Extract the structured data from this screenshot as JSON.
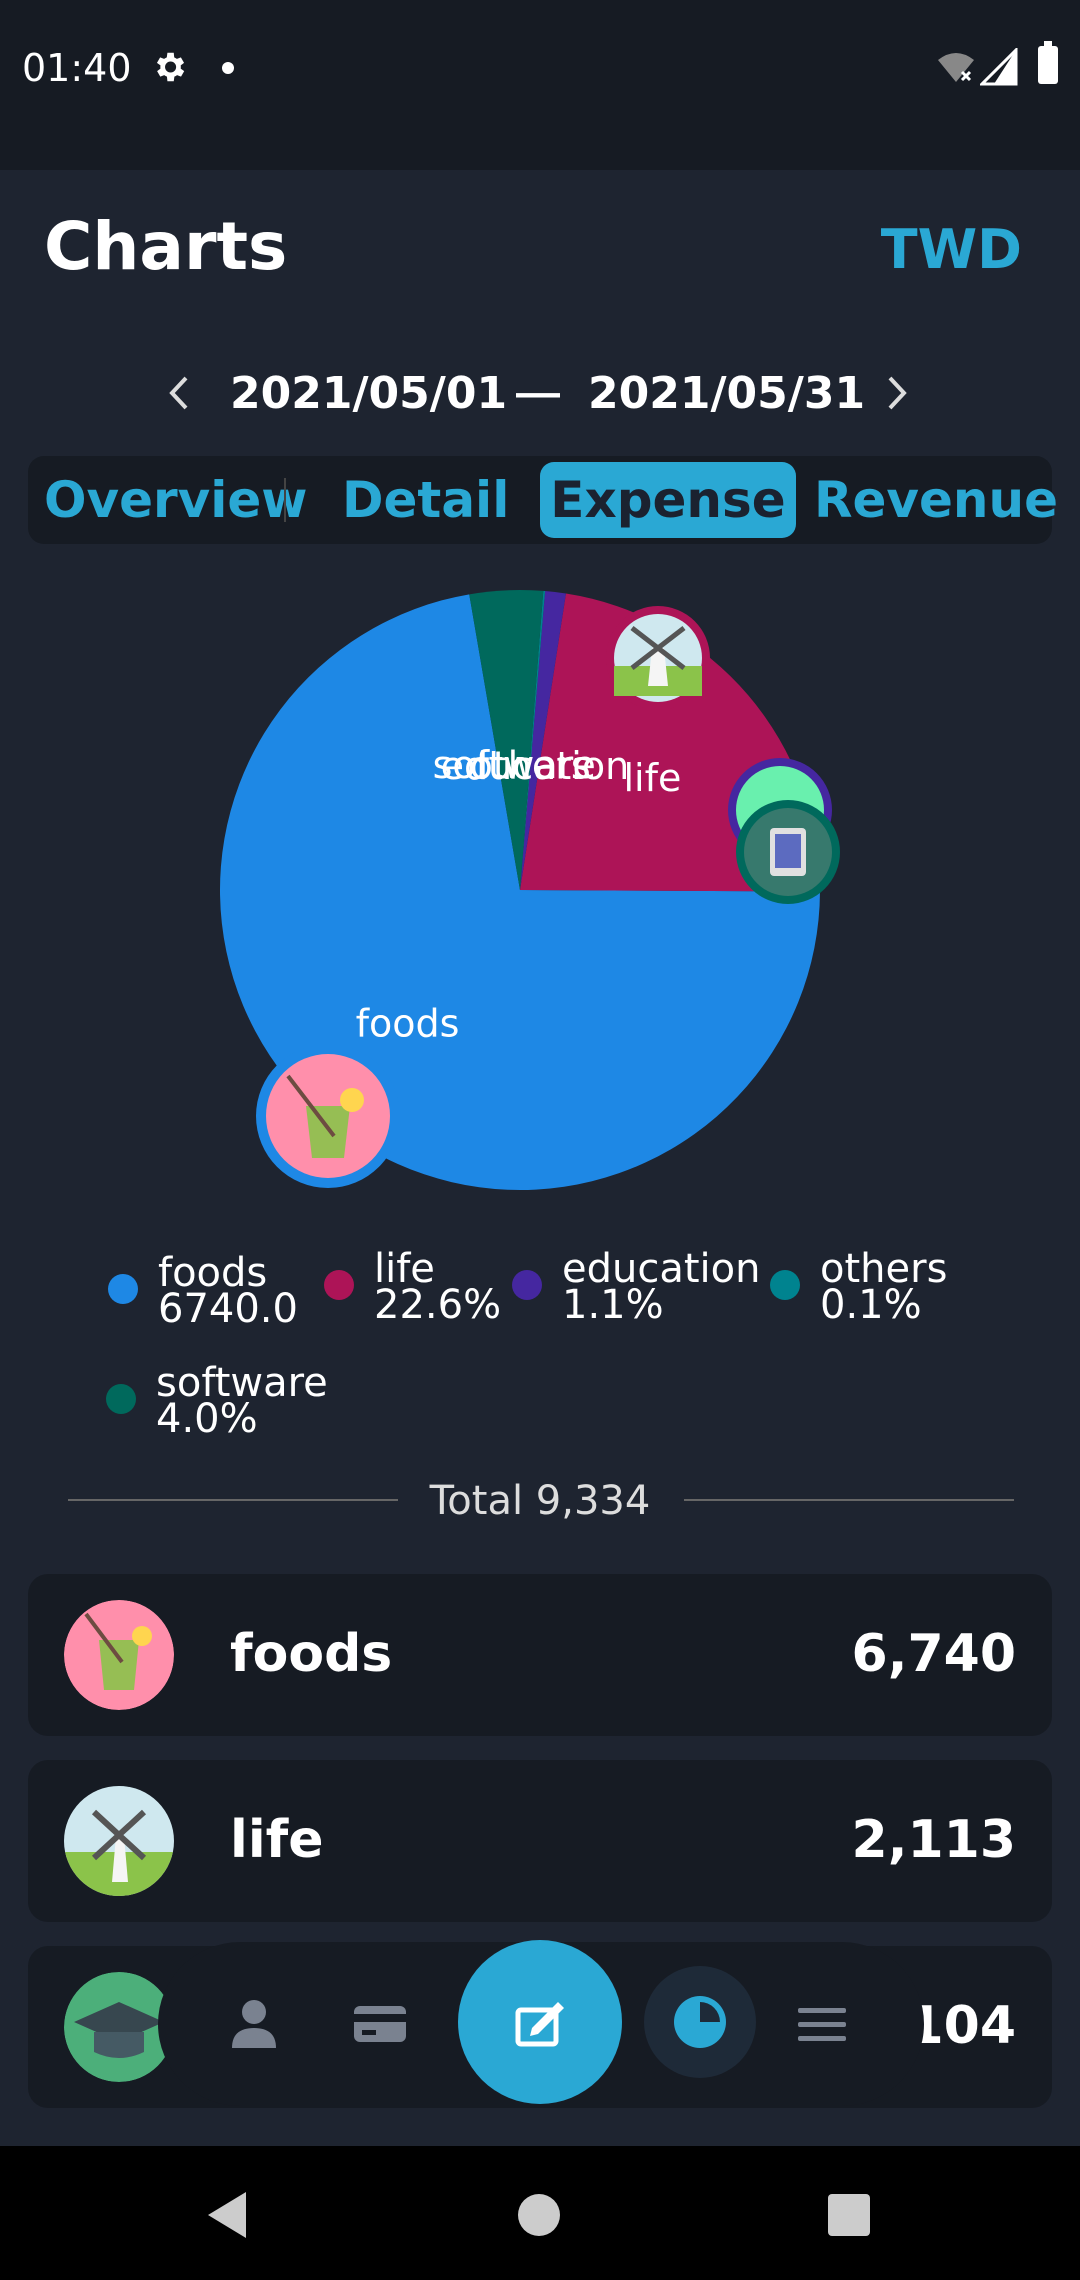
{
  "status": {
    "time": "01:40"
  },
  "header": {
    "title": "Charts",
    "currency": "TWD"
  },
  "date_range": {
    "start": "2021/05/01",
    "separator": "—",
    "end": "2021/05/31"
  },
  "tabs": [
    {
      "label": "Overview"
    },
    {
      "label": "Detail"
    },
    {
      "label": "Expense",
      "selected": true
    },
    {
      "label": "Revenue"
    }
  ],
  "chart_data": {
    "type": "pie",
    "slices": [
      {
        "label": "foods",
        "value": 6740.0,
        "color": "#1e88e5"
      },
      {
        "label": "life",
        "value": 2113,
        "color": "#ad1457"
      },
      {
        "label": "education",
        "value": 104,
        "color": "#4527a0"
      },
      {
        "label": "others",
        "value": 9,
        "color": "#00838f"
      },
      {
        "label": "software",
        "value": 368,
        "color": "#00695c"
      }
    ]
  },
  "legend": [
    {
      "name": "foods",
      "value": "6740.0",
      "color": "#1e88e5"
    },
    {
      "name": "life",
      "value": "22.6%",
      "color": "#ad1457"
    },
    {
      "name": "education",
      "value": "1.1%",
      "color": "#4527a0"
    },
    {
      "name": "others",
      "value": "0.1%",
      "color": "#00838f"
    },
    {
      "name": "software",
      "value": "4.0%",
      "color": "#00695c"
    }
  ],
  "total": {
    "label": "Total 9,334"
  },
  "rows": [
    {
      "name": "foods",
      "amount": "6,740",
      "icon": "drink-icon"
    },
    {
      "name": "life",
      "amount": "2,113",
      "icon": "windmill-icon"
    },
    {
      "name": "education",
      "amount": "104",
      "icon": "graduation-cap-icon"
    }
  ],
  "colors": {
    "accent": "#2aa8d4",
    "background": "#1e2430",
    "card": "#161b23"
  }
}
